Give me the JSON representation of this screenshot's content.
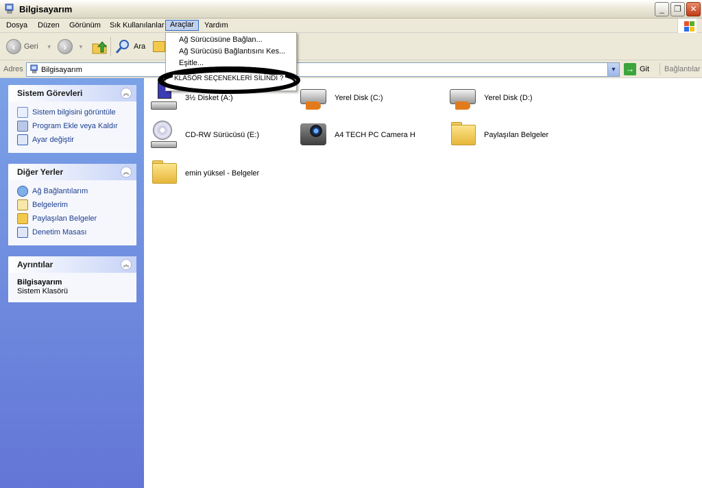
{
  "window": {
    "title": "Bilgisayarım",
    "icon": "my-computer-icon"
  },
  "menubar": {
    "items": [
      "Dosya",
      "Düzen",
      "Görünüm",
      "Sık Kullanılanlar",
      "Araçlar",
      "Yardım"
    ],
    "active": "Araçlar"
  },
  "toolbar": {
    "back_label": "Geri",
    "search_label": "Ara"
  },
  "address": {
    "label": "Adres",
    "value": "Bilgisayarım",
    "go_label": "Git",
    "links_label": "Bağlantılar"
  },
  "tools_menu": {
    "items": [
      "Ağ Sürücüsüne Bağlan...",
      "Ağ Sürücüsü Bağlantısını Kes...",
      "Eşitle..."
    ],
    "annotation": "KLASÖR SEÇENEKLERİ SİLİNDİ ?"
  },
  "taskpane": {
    "system_tasks": {
      "title": "Sistem Görevleri",
      "items": [
        "Sistem bilgisini görüntüle",
        "Program Ekle veya Kaldır",
        "Ayar değiştir"
      ]
    },
    "other_places": {
      "title": "Diğer Yerler",
      "items": [
        "Ağ Bağlantılarım",
        "Belgelerim",
        "Paylaşılan Belgeler",
        "Denetim Masası"
      ]
    },
    "details": {
      "title": "Ayrıntılar",
      "name": "Bilgisayarım",
      "type": "Sistem Klasörü"
    }
  },
  "drives": [
    {
      "label": "3½ Disket (A:)",
      "icon": "floppy-drive-icon"
    },
    {
      "label": "Yerel Disk (C:)",
      "icon": "hard-disk-icon"
    },
    {
      "label": "Yerel Disk (D:)",
      "icon": "hard-disk-icon"
    },
    {
      "label": "CD-RW Sürücüsü (E:)",
      "icon": "cd-drive-icon"
    },
    {
      "label": "A4 TECH PC Camera H",
      "icon": "camera-icon"
    },
    {
      "label": "Paylaşılan Belgeler",
      "icon": "folder-icon"
    },
    {
      "label": "emin yüksel - Belgeler",
      "icon": "folder-icon"
    }
  ]
}
